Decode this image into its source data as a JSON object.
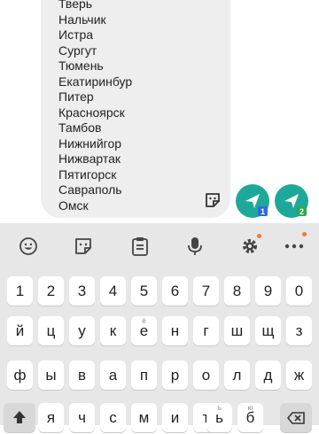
{
  "message": {
    "lines": [
      "Тверь",
      "Нальчик",
      "Истра",
      "Сургут",
      "Тюмень",
      "Екатиринбур",
      "Питер",
      "Красноярск",
      "Тамбов",
      "Нижнийгор",
      "Нижвартак",
      "Пятигорск",
      "Савраполь",
      "Омск"
    ]
  },
  "send_buttons": [
    {
      "sim": "1",
      "color": "#2e6bd8"
    },
    {
      "sim": "2",
      "color": "#2fa84f"
    }
  ],
  "accent_color": "#1ea89a",
  "keyboard": {
    "toolbar": [
      "emoji-icon",
      "sticker-icon",
      "clipboard-icon",
      "microphone-icon",
      "settings-icon",
      "more-icon"
    ],
    "number_row": [
      "1",
      "2",
      "3",
      "4",
      "5",
      "6",
      "7",
      "8",
      "9",
      "0"
    ],
    "row1": [
      "й",
      "ц",
      "у",
      "к",
      "е",
      "н",
      "г",
      "ш",
      "щ",
      "з"
    ],
    "row1_hint_e": "ё",
    "row2": [
      "ф",
      "ы",
      "в",
      "а",
      "п",
      "р",
      "о",
      "л",
      "д",
      "ж"
    ],
    "row3": [
      "я",
      "ч",
      "с",
      "м",
      "и",
      "т",
      "ь",
      "б"
    ],
    "row3_hint_soft": "ъ",
    "row3_hint_b": "ю"
  }
}
